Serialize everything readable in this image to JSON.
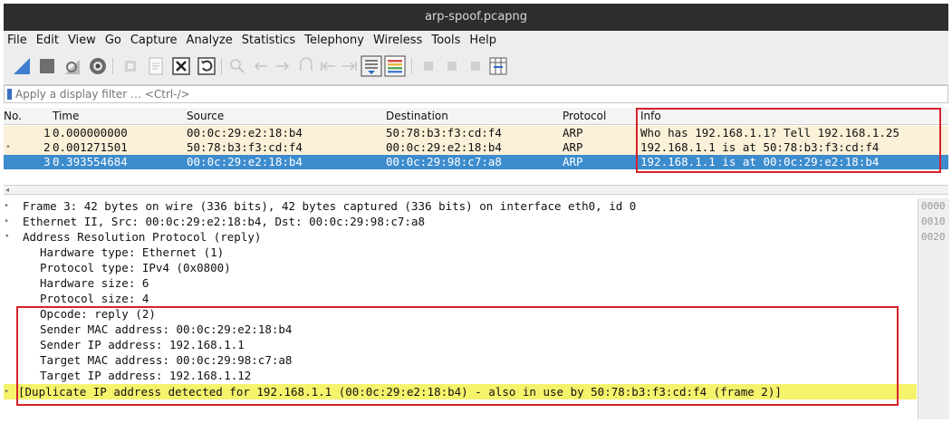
{
  "window": {
    "title": "arp-spoof.pcapng"
  },
  "menu": {
    "items": [
      {
        "label": "File"
      },
      {
        "label": "Edit"
      },
      {
        "label": "View"
      },
      {
        "label": "Go"
      },
      {
        "label": "Capture"
      },
      {
        "label": "Analyze"
      },
      {
        "label": "Statistics"
      },
      {
        "label": "Telephony"
      },
      {
        "label": "Wireless"
      },
      {
        "label": "Tools"
      },
      {
        "label": "Help"
      }
    ]
  },
  "toolbar": {
    "buttons": [
      {
        "icon": "shark-fin-start-icon"
      },
      {
        "icon": "stop-capture-icon"
      },
      {
        "icon": "restart-capture-icon"
      },
      {
        "icon": "capture-options-icon"
      },
      {
        "icon": "open-file-icon"
      },
      {
        "icon": "save-file-icon"
      },
      {
        "icon": "close-file-icon"
      },
      {
        "icon": "reload-icon"
      },
      {
        "icon": "find-packet-icon"
      },
      {
        "icon": "go-back-icon"
      },
      {
        "icon": "go-forward-icon"
      },
      {
        "icon": "go-to-packet-icon"
      },
      {
        "icon": "first-packet-icon"
      },
      {
        "icon": "last-packet-icon"
      },
      {
        "icon": "autoscroll-icon"
      },
      {
        "icon": "colorize-icon"
      },
      {
        "icon": "zoom-in-icon"
      },
      {
        "icon": "zoom-out-icon"
      },
      {
        "icon": "normal-size-icon"
      },
      {
        "icon": "resize-columns-icon"
      }
    ]
  },
  "filter": {
    "placeholder": "Apply a display filter … <Ctrl-/>"
  },
  "packet_list": {
    "columns": [
      "No.",
      "Time",
      "Source",
      "Destination",
      "Protocol",
      "Info"
    ],
    "rows": [
      {
        "no": "1",
        "time": "0.000000000",
        "source": "00:0c:29:e2:18:b4",
        "destination": "50:78:b3:f3:cd:f4",
        "protocol": "ARP",
        "info": "Who has 192.168.1.1? Tell 192.168.1.25",
        "marker": ""
      },
      {
        "no": "2",
        "time": "0.001271501",
        "source": "50:78:b3:f3:cd:f4",
        "destination": "00:0c:29:e2:18:b4",
        "protocol": "ARP",
        "info": "192.168.1.1 is at 50:78:b3:f3:cd:f4",
        "marker": "•"
      },
      {
        "no": "3",
        "time": "0.393554684",
        "source": "00:0c:29:e2:18:b4",
        "destination": "00:0c:29:98:c7:a8",
        "protocol": "ARP",
        "info": "192.168.1.1 is at 00:0c:29:e2:18:b4",
        "marker": ""
      }
    ],
    "selected_row": 3,
    "colors": {
      "arp_row": "#fbf0d8",
      "selected": "#3d8ccd",
      "highlight_box": "#d6212b"
    }
  },
  "details": {
    "lines": [
      {
        "toggle": "▸",
        "text": "Frame 3: 42 bytes on wire (336 bits), 42 bytes captured (336 bits) on interface eth0, id 0"
      },
      {
        "toggle": "▸",
        "text": "Ethernet II, Src: 00:0c:29:e2:18:b4, Dst: 00:0c:29:98:c7:a8"
      },
      {
        "toggle": "▾",
        "text": "Address Resolution Protocol (reply)"
      },
      {
        "toggle": "",
        "text": "Hardware type: Ethernet (1)"
      },
      {
        "toggle": "",
        "text": "Protocol type: IPv4 (0x0800)"
      },
      {
        "toggle": "",
        "text": "Hardware size: 6"
      },
      {
        "toggle": "",
        "text": "Protocol size: 4"
      },
      {
        "toggle": "",
        "text": "Opcode: reply (2)"
      },
      {
        "toggle": "",
        "text": "Sender MAC address: 00:0c:29:e2:18:b4"
      },
      {
        "toggle": "",
        "text": "Sender IP address: 192.168.1.1"
      },
      {
        "toggle": "",
        "text": "Target MAC address: 00:0c:29:98:c7:a8"
      },
      {
        "toggle": "",
        "text": "Target IP address: 192.168.1.12"
      },
      {
        "toggle": "▸",
        "text": "[Duplicate IP address detected for 192.168.1.1 (00:0c:29:e2:18:b4) - also in use by 50:78:b3:f3:cd:f4 (frame 2)]"
      }
    ],
    "highlight_color": "#f5f36c"
  },
  "hex_pane": {
    "offsets": [
      "0000",
      "0010",
      "0020"
    ]
  }
}
